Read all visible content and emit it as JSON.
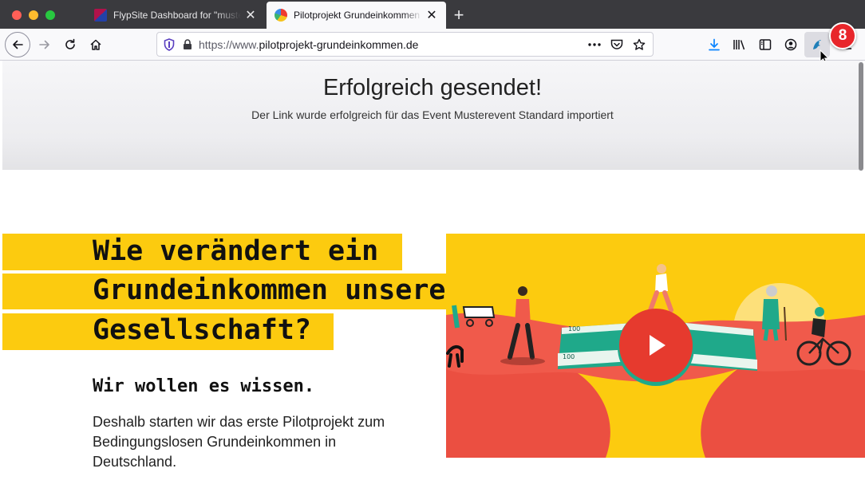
{
  "browser": {
    "tabs": [
      {
        "title": "FlypSite Dashboard for \"muster",
        "active": false
      },
      {
        "title": "Pilotprojekt Grundeinkommen -",
        "active": true
      }
    ],
    "url": {
      "scheme": "https://www.",
      "host": "pilotprojekt-grundeinkommen.de"
    },
    "extension_badge": "8"
  },
  "banner": {
    "title": "Erfolgreich gesendet!",
    "message": "Der Link wurde erfolgreich für das Event Musterevent Standard importiert"
  },
  "hero": {
    "headline_lines": [
      "Wie verändert ein",
      "Grundeinkommen unsere",
      "Gesellschaft?"
    ],
    "subheadline": "Wir wollen es wissen.",
    "body": "Deshalb starten wir das erste Pilotprojekt zum Bedingungslosen Grundeinkommen in Deutschland."
  },
  "colors": {
    "accent_yellow": "#fccb0f",
    "play_red": "#e63a2e",
    "illustration_coral": "#f05a4b",
    "badge_red": "#e8262b"
  },
  "icons": {
    "back": "arrow-left-icon",
    "forward": "arrow-right-icon",
    "reload": "reload-icon",
    "home": "home-icon",
    "tracking": "shield-icon",
    "lock": "lock-icon",
    "more": "more-icon",
    "pocket": "pocket-icon",
    "bookmark": "star-icon",
    "downloads": "download-icon",
    "library": "library-icon",
    "sidebar": "sidebar-icon",
    "account": "account-icon",
    "extension": "dolphin-icon",
    "menu": "menu-icon"
  }
}
